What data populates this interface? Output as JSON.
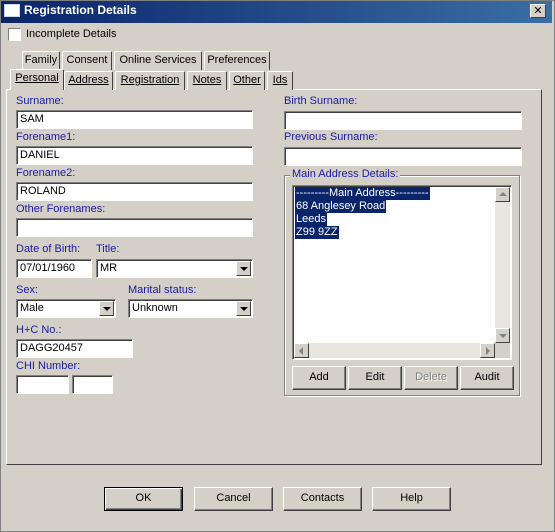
{
  "window": {
    "title": "Registration Details",
    "close_glyph": "✕",
    "close_icon": "close-icon"
  },
  "incomplete": {
    "label": "Incomplete Details",
    "checked": false
  },
  "tabs_back": [
    {
      "label": "Family"
    },
    {
      "label": "Consent"
    },
    {
      "label": "Online Services"
    },
    {
      "label": "Preferences"
    }
  ],
  "tabs_front": [
    {
      "label": "Personal",
      "active": true
    },
    {
      "label": "Address"
    },
    {
      "label": "Registration"
    },
    {
      "label": "Notes"
    },
    {
      "label": "Other"
    },
    {
      "label": "Ids"
    }
  ],
  "personal": {
    "surname_label": "Surname:",
    "surname_value": "SAM",
    "forename1_label": "Forename1:",
    "forename1_value": "DANIEL",
    "forename2_label": "Forename2:",
    "forename2_value": "ROLAND",
    "other_forenames_label": "Other Forenames:",
    "other_forenames_value": "",
    "dob_label": "Date of Birth:",
    "dob_value": "07/01/1960",
    "title_label": "Title:",
    "title_value": "MR",
    "sex_label": "Sex:",
    "sex_value": "Male",
    "marital_label": "Marital status:",
    "marital_value": "Unknown",
    "hc_label": "H+C No.:",
    "hc_value": "DAGG20457",
    "chi_label": "CHI Number:",
    "chi_value_1": "",
    "chi_value_2": "",
    "birth_surname_label": "Birth Surname:",
    "birth_surname_value": "",
    "previous_surname_label": "Previous Surname:",
    "previous_surname_value": ""
  },
  "address": {
    "group_label": "Main Address Details:",
    "lines": [
      "---------Main Address---------",
      "68 Anglesey Road",
      "Leeds",
      "Z99 9ZZ"
    ],
    "buttons": {
      "add": "Add",
      "edit": "Edit",
      "delete": "Delete",
      "audit": "Audit"
    }
  },
  "footer": {
    "ok": "OK",
    "cancel": "Cancel",
    "contacts": "Contacts",
    "help": "Help"
  },
  "colors": {
    "titlebar": "#0a246a",
    "label_blue": "#1a1aa6",
    "selection": "#0a246a",
    "face": "#d4d0c8"
  }
}
